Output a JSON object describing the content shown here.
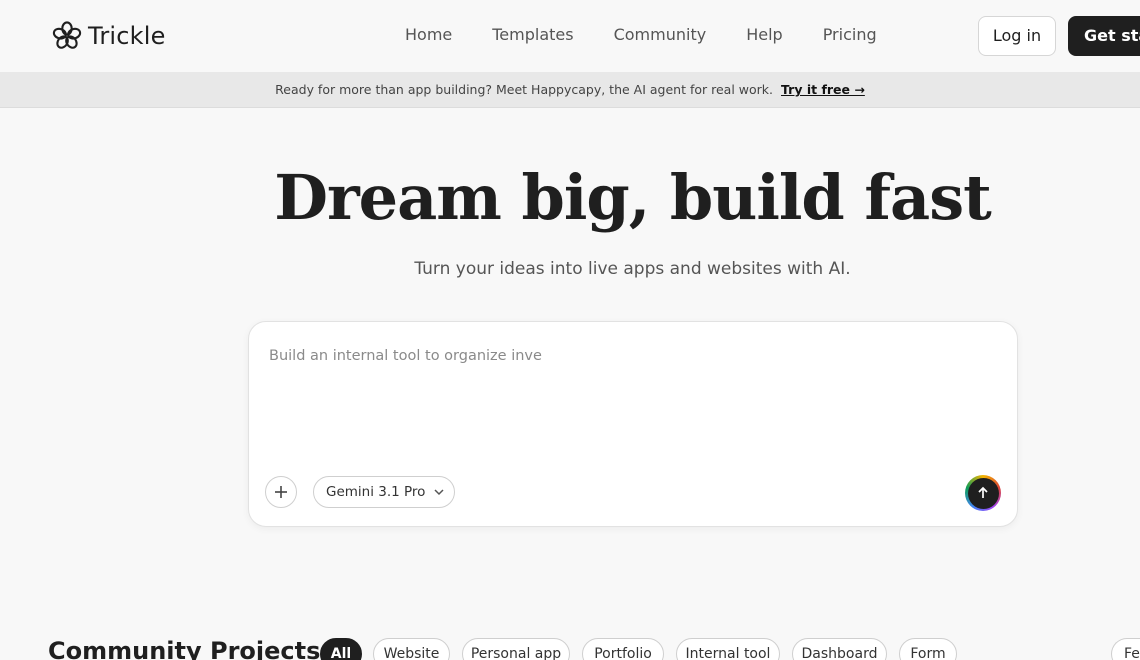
{
  "brand": {
    "name": "Trickle",
    "logo_icon": "flower-logo-icon"
  },
  "nav": {
    "items": [
      "Home",
      "Templates",
      "Community",
      "Help",
      "Pricing"
    ]
  },
  "header_actions": {
    "login_label": "Log in",
    "get_started_label": "Get star"
  },
  "banner": {
    "text": "Ready for more than app building? Meet Happycapy, the AI agent for real work.",
    "link": "Try it free →"
  },
  "hero": {
    "title": "Dream big, build fast",
    "subtitle": "Turn your ideas into live apps and websites with AI."
  },
  "prompt": {
    "placeholder": "Build an internal tool to organize inve",
    "model": "Gemini 3.1 Pro",
    "add_icon": "plus-icon",
    "send_icon": "arrow-up-icon"
  },
  "community": {
    "title": "Community Projects",
    "filters": [
      "All",
      "Website",
      "Personal app",
      "Portfolio",
      "Internal tool",
      "Dashboard",
      "Form",
      "Fea"
    ],
    "active_filter": "All"
  },
  "colors": {
    "primary_dark": "#1f1f1f",
    "background": "#f8f8f8",
    "banner": "#e8e8e8"
  }
}
